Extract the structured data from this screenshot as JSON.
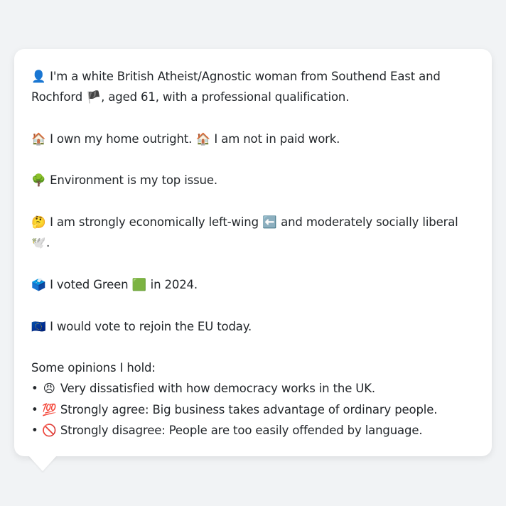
{
  "profile": {
    "identity": {
      "icon": "👤",
      "text": "I'm a white British Atheist/Agnostic woman from Southend East and Rochford",
      "flag": "🏴",
      "text_after": ", aged 61, with a professional qualification."
    },
    "housing": {
      "icon1": "🏠",
      "text1": "I own my home outright.",
      "icon2": "🏠",
      "text2": "I am not in paid work."
    },
    "top_issue": {
      "icon": "🌳",
      "text": "Environment is my top issue."
    },
    "politics": {
      "icon": "🤔",
      "text1": "I am strongly economically left-wing",
      "icon_left": "⬅️",
      "text2": "and moderately socially liberal",
      "icon_dove": "🕊️",
      "text_end": "."
    },
    "vote": {
      "icon": "🗳️",
      "text1": "I voted Green",
      "icon_green": "🟩",
      "text2": "in 2024."
    },
    "eu": {
      "icon": "🇪🇺",
      "text": "I would vote to rejoin the EU today."
    },
    "opinions": {
      "heading": "Some opinions I hold:",
      "items": [
        {
          "bullet": "•",
          "icon": "😠",
          "text": "Very dissatisfied with how democracy works in the UK."
        },
        {
          "bullet": "•",
          "icon": "💯",
          "text": "Strongly agree: Big business takes advantage of ordinary people."
        },
        {
          "bullet": "•",
          "icon": "🚫",
          "text": "Strongly disagree: People are too easily offended by language."
        }
      ]
    }
  },
  "colors": {
    "page_background": "#f1f3f5",
    "card_background": "#ffffff",
    "text": "#22262a"
  }
}
